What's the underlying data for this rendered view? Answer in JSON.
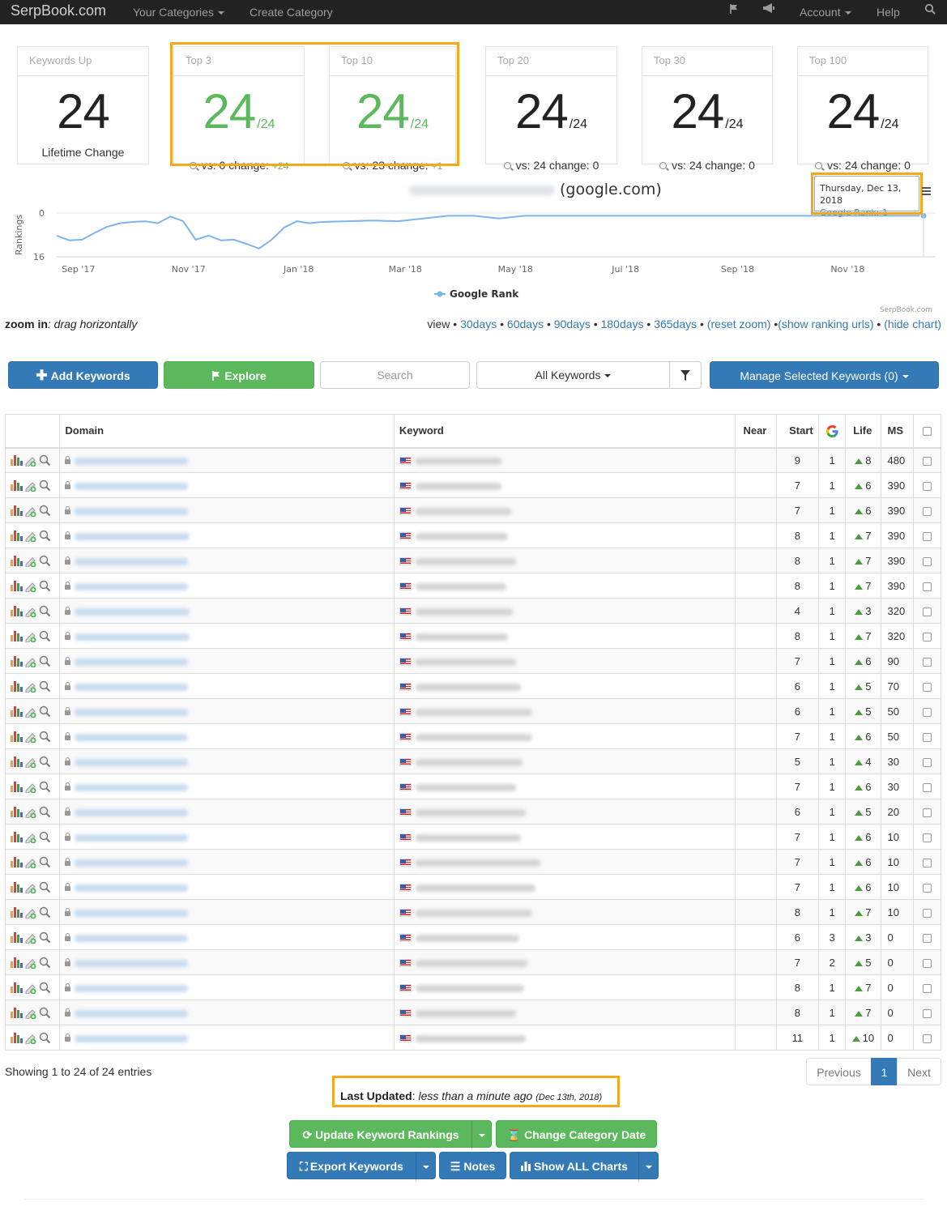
{
  "nav": {
    "brand": "SerpBook.com",
    "your_categories": "Your Categories",
    "create_category": "Create Category",
    "account": "Account",
    "help": "Help"
  },
  "cards": [
    {
      "title": "Keywords Up",
      "value": "24",
      "denominator": "",
      "footer": "Lifetime Change",
      "change": ""
    },
    {
      "title": "Top 3",
      "value": "24",
      "denominator": "/24",
      "footer": "vs: 0 change:",
      "change": "+24"
    },
    {
      "title": "Top 10",
      "value": "24",
      "denominator": "/24",
      "footer": "vs: 23 change:",
      "change": "+1"
    },
    {
      "title": "Top 20",
      "value": "24",
      "denominator": "/24",
      "footer": "vs: 24 change: 0",
      "change": ""
    },
    {
      "title": "Top 30",
      "value": "24",
      "denominator": "/24",
      "footer": "vs: 24 change: 0",
      "change": ""
    },
    {
      "title": "Top 100",
      "value": "24",
      "denominator": "/24",
      "footer": "vs: 24 change: 0",
      "change": ""
    }
  ],
  "chart": {
    "title_suffix": "(google.com)",
    "tooltip_date": "Thursday, Dec 13, 2018",
    "tooltip_label": "Google Rank:",
    "tooltip_value": "1",
    "credit": "SerpBook.com"
  },
  "chart_data": {
    "type": "line",
    "title": "(google.com)",
    "xlabel": "",
    "ylabel": "Rankings",
    "ylim": [
      16,
      0
    ],
    "y_reversed": true,
    "x_ticks": [
      "Sep '17",
      "Nov '17",
      "Jan '18",
      "Mar '18",
      "May '18",
      "Jul '18",
      "Sep '18",
      "Nov '18"
    ],
    "y_ticks": [
      "0",
      "16"
    ],
    "legend": "bottom-center",
    "series": [
      {
        "name": "Google Rank",
        "color": "#7cb5ec",
        "x": [
          "2017-08-20",
          "2017-08-27",
          "2017-09-03",
          "2017-09-10",
          "2017-09-17",
          "2017-09-24",
          "2017-10-01",
          "2017-10-08",
          "2017-10-15",
          "2017-10-22",
          "2017-10-29",
          "2017-11-05",
          "2017-11-12",
          "2017-11-19",
          "2017-11-26",
          "2017-12-03",
          "2017-12-10",
          "2017-12-17",
          "2017-12-24",
          "2017-12-31",
          "2018-01-07",
          "2018-01-14",
          "2018-01-28",
          "2018-02-11",
          "2018-02-25",
          "2018-03-11",
          "2018-03-25",
          "2018-04-08",
          "2018-04-22",
          "2018-05-06",
          "2018-05-20",
          "2018-06-10",
          "2018-07-01",
          "2018-07-22",
          "2018-08-12",
          "2018-09-02",
          "2018-09-23",
          "2018-10-14",
          "2018-11-04",
          "2018-11-25",
          "2018-12-13"
        ],
        "values": [
          9,
          10,
          9,
          8,
          5,
          3,
          4,
          3,
          3,
          2,
          3,
          9,
          9,
          10,
          9,
          12,
          13,
          9,
          6,
          3,
          3,
          4,
          3,
          2,
          3,
          2,
          1,
          1,
          2,
          1,
          1,
          1,
          1,
          1,
          1,
          1,
          1,
          1,
          1,
          1,
          1
        ]
      }
    ]
  },
  "zoom": {
    "bold": "zoom in",
    "hint": ": drag horizontally"
  },
  "viewbar": {
    "label": "view •",
    "links": [
      "30days",
      "60days",
      "90days",
      "180days",
      "365days",
      "(reset zoom)",
      "(show ranking urls)",
      "(hide chart)"
    ]
  },
  "toolbar": {
    "add_keywords": "Add Keywords",
    "explore": "Explore",
    "search_placeholder": "Search",
    "filter_select": "All Keywords",
    "manage": "Manage Selected Keywords (0)"
  },
  "table": {
    "headers": {
      "domain": "Domain",
      "keyword": "Keyword",
      "near": "Near",
      "start": "Start",
      "life": "Life",
      "ms": "MS"
    },
    "rows": [
      {
        "start": "9",
        "google": "1",
        "life": "8",
        "ms": "480"
      },
      {
        "start": "7",
        "google": "1",
        "life": "6",
        "ms": "390"
      },
      {
        "start": "7",
        "google": "1",
        "life": "6",
        "ms": "390"
      },
      {
        "start": "8",
        "google": "1",
        "life": "7",
        "ms": "390"
      },
      {
        "start": "8",
        "google": "1",
        "life": "7",
        "ms": "390"
      },
      {
        "start": "8",
        "google": "1",
        "life": "7",
        "ms": "390"
      },
      {
        "start": "4",
        "google": "1",
        "life": "3",
        "ms": "320"
      },
      {
        "start": "8",
        "google": "1",
        "life": "7",
        "ms": "320"
      },
      {
        "start": "7",
        "google": "1",
        "life": "6",
        "ms": "90"
      },
      {
        "start": "6",
        "google": "1",
        "life": "5",
        "ms": "70"
      },
      {
        "start": "6",
        "google": "1",
        "life": "5",
        "ms": "50"
      },
      {
        "start": "7",
        "google": "1",
        "life": "6",
        "ms": "50"
      },
      {
        "start": "5",
        "google": "1",
        "life": "4",
        "ms": "30"
      },
      {
        "start": "7",
        "google": "1",
        "life": "6",
        "ms": "30"
      },
      {
        "start": "6",
        "google": "1",
        "life": "5",
        "ms": "20"
      },
      {
        "start": "7",
        "google": "1",
        "life": "6",
        "ms": "10"
      },
      {
        "start": "7",
        "google": "1",
        "life": "6",
        "ms": "10"
      },
      {
        "start": "7",
        "google": "1",
        "life": "6",
        "ms": "10"
      },
      {
        "start": "8",
        "google": "1",
        "life": "7",
        "ms": "10"
      },
      {
        "start": "6",
        "google": "3",
        "life": "3",
        "ms": "0"
      },
      {
        "start": "7",
        "google": "2",
        "life": "5",
        "ms": "0"
      },
      {
        "start": "8",
        "google": "1",
        "life": "7",
        "ms": "0"
      },
      {
        "start": "8",
        "google": "1",
        "life": "7",
        "ms": "0"
      },
      {
        "start": "11",
        "google": "1",
        "life": "10",
        "ms": "0"
      }
    ]
  },
  "footer": {
    "showing": "Showing 1 to 24 of 24 entries",
    "previous": "Previous",
    "page": "1",
    "next": "Next",
    "last_updated_label": "Last Updated",
    "last_updated_value": "less than a minute ago",
    "last_updated_date": "(Dec 13th, 2018)",
    "update_rankings": "Update Keyword Rankings",
    "change_date": "Change Category Date",
    "export": "Export Keywords",
    "notes": "Notes",
    "show_charts": "Show ALL Charts"
  },
  "colors": {
    "navbar": "#222222",
    "primary": "#337ab7",
    "success": "#5cb85c",
    "highlight": "#f5a81c",
    "line": "#7cb5ec"
  }
}
